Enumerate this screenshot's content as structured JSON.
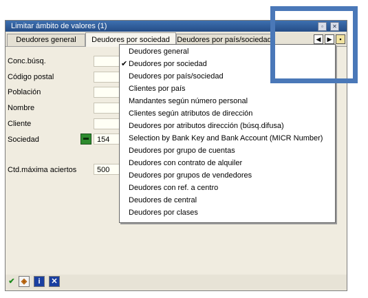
{
  "window": {
    "title": "Limitar ámbito de valores (1)"
  },
  "tabs": [
    {
      "label": "Deudores general",
      "active": false
    },
    {
      "label": "Deudores por sociedad",
      "active": true
    },
    {
      "label": "Deudores por país/sociedad",
      "active": false
    }
  ],
  "tab_nav": {
    "prev_icon": "◀",
    "next_icon": "▶"
  },
  "form": {
    "fields": [
      {
        "label": "Conc.búsq.",
        "value": ""
      },
      {
        "label": "Código postal",
        "value": ""
      },
      {
        "label": "Población",
        "value": ""
      },
      {
        "label": "Nombre",
        "value": ""
      },
      {
        "label": "Cliente",
        "value": ""
      },
      {
        "label": "Sociedad",
        "value": "154"
      },
      {
        "label": "Ctd.máxima aciertos",
        "value": "500"
      }
    ]
  },
  "menu": {
    "items": [
      {
        "label": "Deudores general",
        "checked": false
      },
      {
        "label": "Deudores por sociedad",
        "checked": true
      },
      {
        "label": "Deudores por país/sociedad",
        "checked": false
      },
      {
        "label": "Clientes por país",
        "checked": false
      },
      {
        "label": "Mandantes según número personal",
        "checked": false
      },
      {
        "label": "Clientes según atributos de dirección",
        "checked": false
      },
      {
        "label": "Deudores por atributos dirección (búsq.difusa)",
        "checked": false
      },
      {
        "label": "Selection by Bank Key and Bank Account (MICR Number)",
        "checked": false
      },
      {
        "label": "Deudores por grupo de cuentas",
        "checked": false
      },
      {
        "label": "Deudores con contrato de alquiler",
        "checked": false
      },
      {
        "label": "Deudores por grupos de vendedores",
        "checked": false
      },
      {
        "label": "Deudores con ref. a centro",
        "checked": false
      },
      {
        "label": "Deudores de central",
        "checked": false
      },
      {
        "label": "Deudores por clases",
        "checked": false
      }
    ],
    "check_glyph": "✔"
  },
  "toolbar": {
    "icons": [
      "check-icon",
      "binoculars-icon",
      "info-icon",
      "cancel-icon"
    ]
  },
  "colors": {
    "title_bar": "#2f5c9a",
    "highlight_box": "#4a78b8",
    "match_button": "#2e8b2e"
  }
}
